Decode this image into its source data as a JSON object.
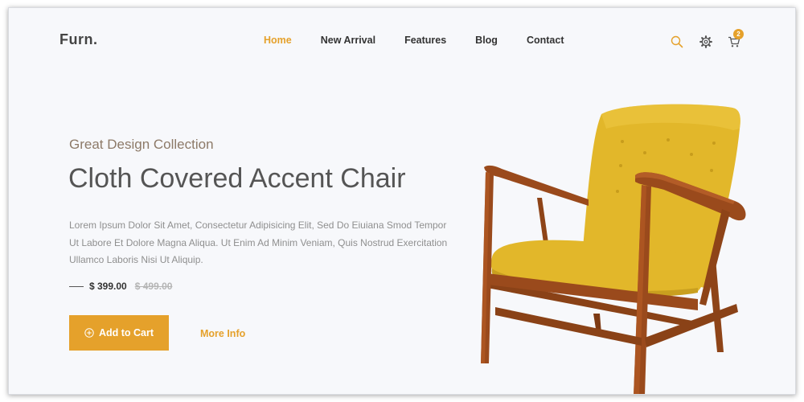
{
  "header": {
    "logo": "Furn.",
    "nav": [
      "Home",
      "New Arrival",
      "Features",
      "Blog",
      "Contact"
    ],
    "active_nav": "Home",
    "icons": [
      "search-icon",
      "gear-icon",
      "cart-icon"
    ],
    "cart_count": "2"
  },
  "hero": {
    "subtitle": "Great Design Collection",
    "title": "Cloth Covered Accent Chair",
    "description": "Lorem Ipsum Dolor Sit Amet, Consectetur Adipisicing Elit, Sed Do Eiuiana Smod Tempor Ut Labore Et Dolore Magna Aliqua. Ut Enim Ad Minim Veniam, Quis Nostrud Exercitation Ullamco Laboris Nisi Ut Aliquip.",
    "price_current": "$ 399.00",
    "price_old": "$ 499.00",
    "add_to_cart_label": "Add to Cart",
    "more_info_label": "More Info"
  },
  "colors": {
    "accent": "#e5a12b",
    "chair_fabric": "#e2b72a",
    "chair_wood": "#9a4a1c"
  }
}
